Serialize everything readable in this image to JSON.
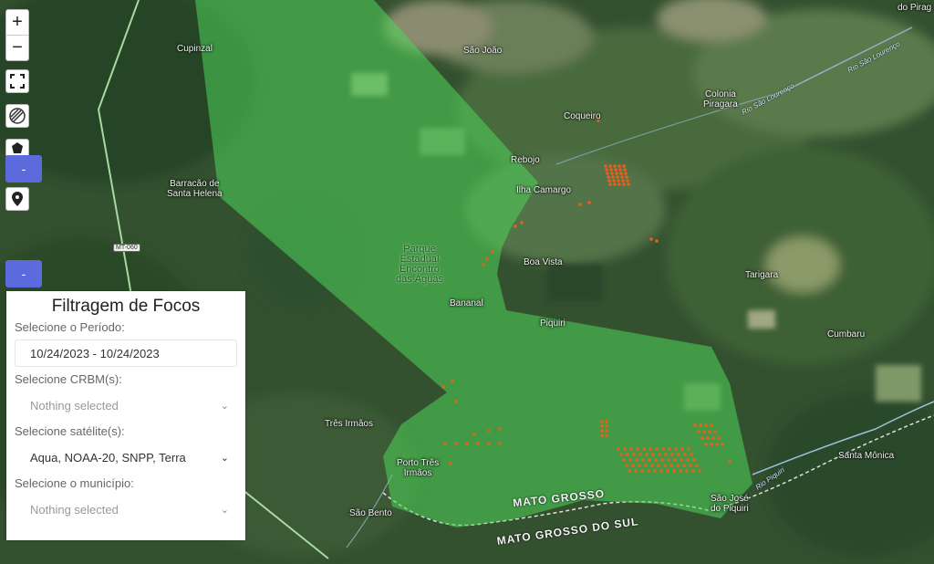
{
  "map": {
    "labels": {
      "cupinzal": "Cupinzal",
      "sao_joao": "São João",
      "coqueiro": "Coqueiro",
      "colonia": "Colonia\nPiragara",
      "rebojo": "Rebojo",
      "barracao": "Barracão de\nSanta Helena",
      "ilha": "Ilha Camargo",
      "boa_vista": "Boa Vista",
      "tarigara": "Tarigara",
      "bananal": "Bananal",
      "piquiri": "Piquiri",
      "cumbaru": "Cumbaru",
      "tres_irmaos": "Três Irmãos",
      "porto_tres": "Porto Três\nIrmãos",
      "santa_monica": "Santa Mônica",
      "sao_jose": "São José\ndo Piquiri",
      "sao_bento": "São Bento",
      "do_pirag": "do Pirag",
      "park": "Parque\nEstadual\nEncontro\ndas Águas",
      "mato_grosso": "MATO GROSSO",
      "mato_grosso_sul": "MATO GROSSO DO SUL",
      "rio_sao_lourenco_1": "Rio São Lourenço",
      "rio_sao_lourenco_2": "Rio São Lourenço",
      "rio_piquiri": "Rio Piquiri",
      "road": "MT-060"
    },
    "colors": {
      "park_fill": "#4fd65a",
      "fire": "#e8601c"
    }
  },
  "controls": {
    "zoom_in": "+",
    "zoom_out": "−",
    "collapse_1": "-",
    "collapse_2": "-",
    "icons": [
      "fullscreen-icon",
      "layers-icon",
      "polygon-draw-icon",
      "marker-icon"
    ]
  },
  "panel": {
    "title": "Filtragem de Focos",
    "period_label": "Selecione o Período:",
    "period_value": "10/24/2023 - 10/24/2023",
    "crbm_label": "Selecione CRBM(s):",
    "crbm_value": "Nothing selected",
    "satellite_label": "Selecione satélite(s):",
    "satellite_value": "Aqua, NOAA-20, SNPP, Terra",
    "municipio_label": "Selecione o município:",
    "municipio_value": "Nothing selected"
  }
}
